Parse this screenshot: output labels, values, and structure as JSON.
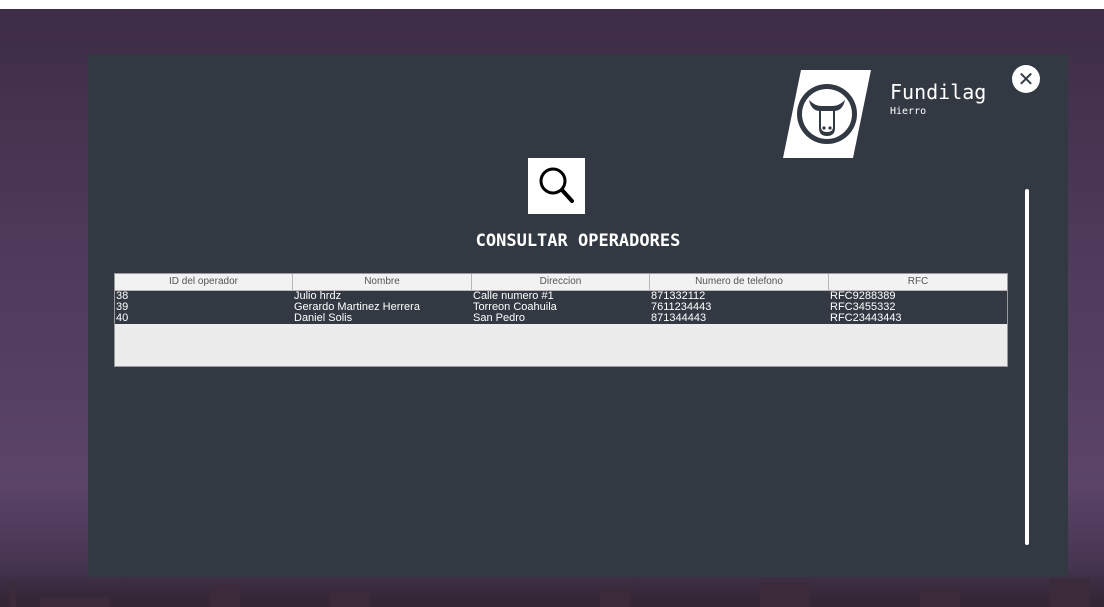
{
  "brand": {
    "name": "Fundilag",
    "subtitle": "Hierro"
  },
  "page": {
    "title": "CONSULTAR OPERADORES"
  },
  "icons": {
    "close": "close-icon",
    "logo": "bull-logo-icon",
    "search": "search-icon"
  },
  "colors": {
    "panel": "#333943",
    "accent": "#ffffff"
  },
  "table": {
    "headers": [
      "ID del operador",
      "Nombre",
      "Direccion",
      "Numero de telefono",
      "RFC"
    ],
    "rows": [
      [
        "38",
        "Julio hrdz",
        "Calle numero #1",
        "871332112",
        "RFC9288389"
      ],
      [
        "39",
        "Gerardo Martinez Herrera",
        "Torreon Coahuila",
        "7611234443",
        "RFC3455332"
      ],
      [
        "40",
        "Daniel Solis",
        "San Pedro",
        "871344443",
        "RFC23443443"
      ]
    ]
  }
}
